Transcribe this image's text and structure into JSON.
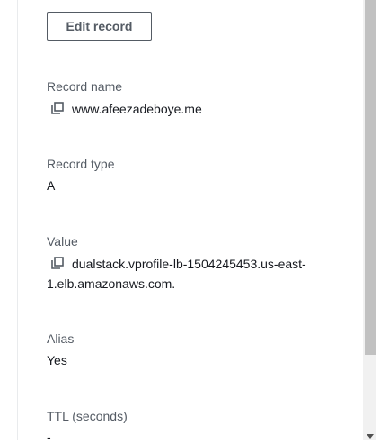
{
  "toolbar": {
    "edit_label": "Edit record"
  },
  "details": {
    "record_name": {
      "label": "Record name",
      "value": "www.afeezadeboye.me"
    },
    "record_type": {
      "label": "Record type",
      "value": "A"
    },
    "value": {
      "label": "Value",
      "line1": "dualstack.vprofile-lb-1504245453.us-east-",
      "line2": "1.elb.amazonaws.com."
    },
    "alias": {
      "label": "Alias",
      "value": "Yes"
    },
    "ttl": {
      "label": "TTL (seconds)",
      "value": "-"
    }
  },
  "icons": {
    "copy": "copy-icon",
    "resize": "resize-handle-icon",
    "scroll_down": "chevron-down-icon"
  }
}
